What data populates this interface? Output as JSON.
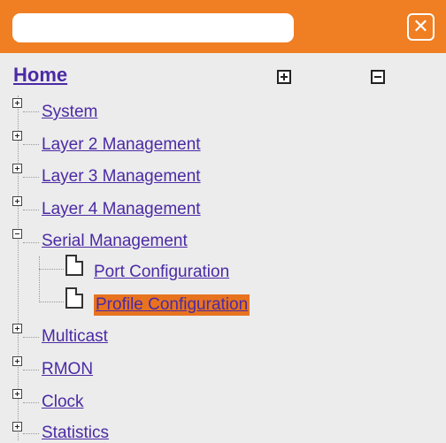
{
  "search": {
    "value": "",
    "placeholder": ""
  },
  "close_icon_char": "✕",
  "tree": {
    "home_label": "Home",
    "items": [
      {
        "label": "System",
        "expanded": false
      },
      {
        "label": "Layer 2 Management",
        "expanded": false
      },
      {
        "label": "Layer 3 Management",
        "expanded": false
      },
      {
        "label": "Layer 4 Management",
        "expanded": false
      },
      {
        "label": "Serial Management",
        "expanded": true,
        "children": [
          {
            "label": "Port Configuration",
            "selected": false
          },
          {
            "label": "Profile Configuration",
            "selected": true
          }
        ]
      },
      {
        "label": "Multicast",
        "expanded": false
      },
      {
        "label": "RMON",
        "expanded": false
      },
      {
        "label": "Clock",
        "expanded": false
      },
      {
        "label": "Statistics",
        "expanded": false
      }
    ]
  },
  "colors": {
    "topbar": "#f07e22",
    "link": "#4b2aa5",
    "selected_bg": "#e8731f",
    "background": "#ececec"
  }
}
